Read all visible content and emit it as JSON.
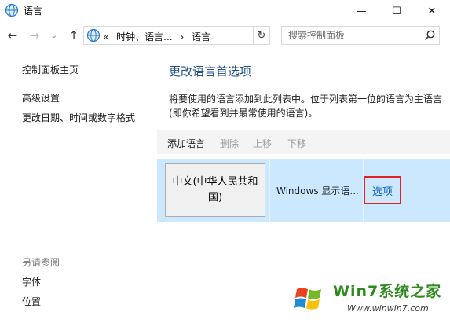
{
  "window": {
    "title": "语言",
    "minimize_glyph": "—",
    "maximize_glyph": "☐",
    "close_glyph": "✕",
    "icon": "globe-clock-icon"
  },
  "nav": {
    "back_glyph": "←",
    "forward_glyph": "→",
    "history_glyph": "⌄",
    "up_glyph": "↑",
    "address": {
      "overflow": "«",
      "crumbs": [
        "时钟、语言...",
        "语言"
      ],
      "separator": "›"
    },
    "refresh_glyph": "↻",
    "search_placeholder": "搜索控制面板"
  },
  "sidebar": {
    "links": [
      "控制面板主页",
      "高级设置",
      "更改日期、时间或数字格式"
    ],
    "see_also_heading": "另请参阅",
    "see_also_links": [
      "字体",
      "位置"
    ]
  },
  "main": {
    "title": "更改语言首选项",
    "description": "将要使用的语言添加到此列表中。位于列表第一位的语言为主语言(即你希望看到并最常使用的语言)。",
    "toolbar": {
      "add": "添加语言",
      "remove": "删除",
      "move_up": "上移",
      "move_down": "下移"
    },
    "language": {
      "name": "中文(中华人民共和国)",
      "status": "Windows 显示语...",
      "options": "选项"
    }
  },
  "watermark": {
    "text": "Win7系统之家",
    "url": "Www.winwin7.com"
  },
  "colors": {
    "title_blue": "#1e4e8c",
    "selection_blue": "#cce8ff",
    "link_blue": "#0b63c4",
    "highlight_red": "#e02424"
  }
}
